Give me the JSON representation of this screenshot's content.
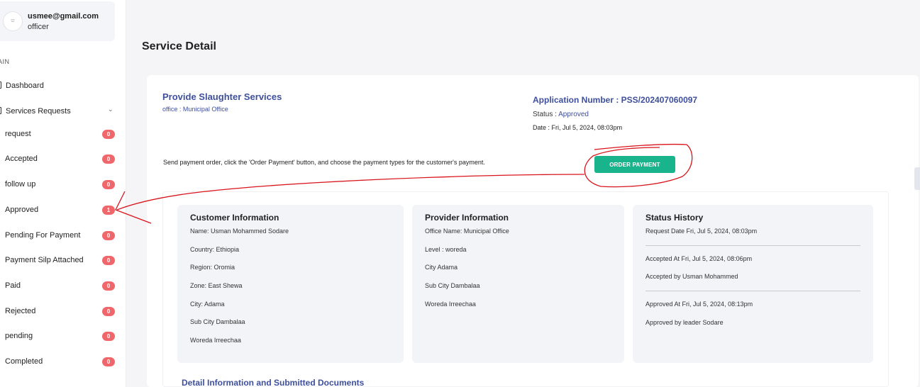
{
  "user": {
    "email": "usmee@gmail.com",
    "role": "officer",
    "avatar_text": "⛫"
  },
  "sidebar": {
    "section_label": "AIN",
    "items": [
      {
        "label": "Dashboard"
      },
      {
        "label": "Services Requests"
      }
    ],
    "sub_items": [
      {
        "label": "request",
        "count": "0"
      },
      {
        "label": "Accepted",
        "count": "0"
      },
      {
        "label": "follow up",
        "count": "0"
      },
      {
        "label": "Approved",
        "count": "1"
      },
      {
        "label": "Pending For Payment",
        "count": "0"
      },
      {
        "label": "Payment Silp Attached",
        "count": "0"
      },
      {
        "label": "Paid",
        "count": "0"
      },
      {
        "label": "Rejected",
        "count": "0"
      },
      {
        "label": "pending",
        "count": "0"
      },
      {
        "label": "Completed",
        "count": "0"
      }
    ]
  },
  "page": {
    "title": "Service Detail"
  },
  "service": {
    "name": "Provide Slaughter Services",
    "office": "office : Municipal Office",
    "application_number": "Application Number : PSS/202407060097",
    "status_label": "Status : ",
    "status_value": "Approved",
    "date": "Date : Fri, Jul 5, 2024, 08:03pm"
  },
  "payment": {
    "note": "Send payment order, click the 'Order Payment' button, and choose the payment types for the customer's payment.",
    "button": "ORDER PAYMENT"
  },
  "customer": {
    "title": "Customer Information",
    "rows": [
      "Name: Usman Mohammed Sodare",
      "Country: Ethiopia",
      "Region: Oromia",
      "Zone: East Shewa",
      "City: Adama",
      "Sub City Dambalaa",
      "Woreda Irreechaa"
    ]
  },
  "provider": {
    "title": "Provider Information",
    "rows": [
      "Office Name: Municipal Office",
      "Level : woreda",
      "City Adama",
      "Sub City Dambalaa",
      "Woreda Irreechaa"
    ]
  },
  "history": {
    "title": "Status History",
    "request_date": "Request Date Fri, Jul 5, 2024, 08:03pm",
    "accepted_at": "Accepted At Fri, Jul 5, 2024, 08:06pm",
    "accepted_by": "Accepted by Usman Mohammed",
    "approved_at": "Approved At Fri, Jul 5, 2024, 08:13pm",
    "approved_by": "Approved by leader Sodare"
  },
  "detail_section": {
    "title": "Detail Information and Submitted Documents"
  },
  "colors": {
    "accent": "#3e4f9e",
    "button": "#19b38c",
    "badge": "#f0676b",
    "annotation": "#d9141c"
  }
}
